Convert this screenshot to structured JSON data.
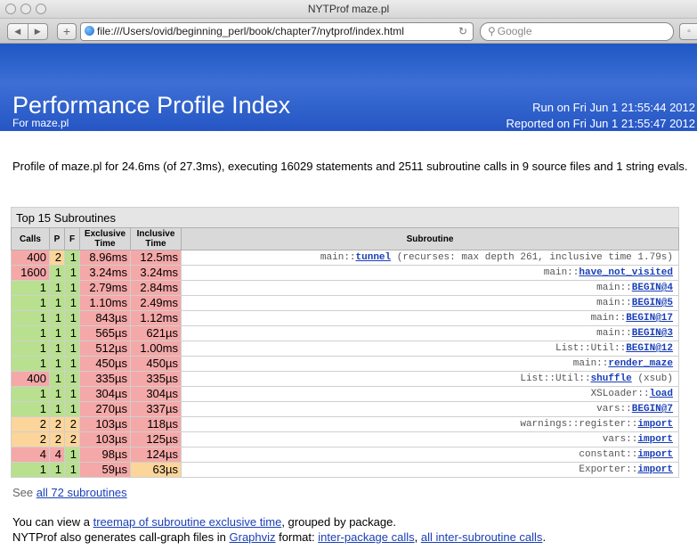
{
  "window": {
    "title": "NYTProf maze.pl"
  },
  "toolbar": {
    "url": "file:///Users/ovid/beginning_perl/book/chapter7/nytprof/index.html",
    "search_placeholder": "Google"
  },
  "header": {
    "title": "Performance Profile Index",
    "subtitle": "For maze.pl",
    "run_on": "Run on Fri Jun 1 21:55:44 2012",
    "reported_on": "Reported on Fri Jun 1 21:55:47 2012"
  },
  "summary": "Profile of maze.pl for 24.6ms (of 27.3ms), executing 16029 statements and 2511 subroutine calls in 9 source files and 1 string evals.",
  "top_subs": {
    "caption": "Top 15 Subroutines",
    "headers": [
      "Calls",
      "P",
      "F",
      "Exclusive Time",
      "Inclusive Time",
      "Subroutine"
    ],
    "rows": [
      {
        "calls": "400",
        "p": "2",
        "f": "1",
        "excl": "8.96ms",
        "incl": "12.5ms",
        "pkg": "main::",
        "name": "tunnel",
        "note": " (recurses: max depth 261, inclusive time 1.79s)",
        "cc": "red",
        "pc": "orange",
        "fc": "green",
        "ec": "red",
        "ic": "red"
      },
      {
        "calls": "1600",
        "p": "1",
        "f": "1",
        "excl": "3.24ms",
        "incl": "3.24ms",
        "pkg": "main::",
        "name": "have_not_visited",
        "note": "",
        "cc": "red",
        "pc": "green",
        "fc": "green",
        "ec": "red",
        "ic": "red"
      },
      {
        "calls": "1",
        "p": "1",
        "f": "1",
        "excl": "2.79ms",
        "incl": "2.84ms",
        "pkg": "main::",
        "name": "BEGIN@4",
        "note": "",
        "cc": "green",
        "pc": "green",
        "fc": "green",
        "ec": "red",
        "ic": "red"
      },
      {
        "calls": "1",
        "p": "1",
        "f": "1",
        "excl": "1.10ms",
        "incl": "2.49ms",
        "pkg": "main::",
        "name": "BEGIN@5",
        "note": "",
        "cc": "green",
        "pc": "green",
        "fc": "green",
        "ec": "red",
        "ic": "red"
      },
      {
        "calls": "1",
        "p": "1",
        "f": "1",
        "excl": "843µs",
        "incl": "1.12ms",
        "pkg": "main::",
        "name": "BEGIN@17",
        "note": "",
        "cc": "green",
        "pc": "green",
        "fc": "green",
        "ec": "red",
        "ic": "red"
      },
      {
        "calls": "1",
        "p": "1",
        "f": "1",
        "excl": "565µs",
        "incl": "621µs",
        "pkg": "main::",
        "name": "BEGIN@3",
        "note": "",
        "cc": "green",
        "pc": "green",
        "fc": "green",
        "ec": "red",
        "ic": "red"
      },
      {
        "calls": "1",
        "p": "1",
        "f": "1",
        "excl": "512µs",
        "incl": "1.00ms",
        "pkg": "List::Util::",
        "name": "BEGIN@12",
        "note": "",
        "cc": "green",
        "pc": "green",
        "fc": "green",
        "ec": "red",
        "ic": "red"
      },
      {
        "calls": "1",
        "p": "1",
        "f": "1",
        "excl": "450µs",
        "incl": "450µs",
        "pkg": "main::",
        "name": "render_maze",
        "note": "",
        "cc": "green",
        "pc": "green",
        "fc": "green",
        "ec": "red",
        "ic": "red"
      },
      {
        "calls": "400",
        "p": "1",
        "f": "1",
        "excl": "335µs",
        "incl": "335µs",
        "pkg": "List::Util::",
        "name": "shuffle",
        "note": " (xsub)",
        "cc": "red",
        "pc": "green",
        "fc": "green",
        "ec": "red",
        "ic": "red"
      },
      {
        "calls": "1",
        "p": "1",
        "f": "1",
        "excl": "304µs",
        "incl": "304µs",
        "pkg": "XSLoader::",
        "name": "load",
        "note": "",
        "cc": "green",
        "pc": "green",
        "fc": "green",
        "ec": "red",
        "ic": "red"
      },
      {
        "calls": "1",
        "p": "1",
        "f": "1",
        "excl": "270µs",
        "incl": "337µs",
        "pkg": "vars::",
        "name": "BEGIN@7",
        "note": "",
        "cc": "green",
        "pc": "green",
        "fc": "green",
        "ec": "red",
        "ic": "red"
      },
      {
        "calls": "2",
        "p": "2",
        "f": "2",
        "excl": "103µs",
        "incl": "118µs",
        "pkg": "warnings::register::",
        "name": "import",
        "note": "",
        "cc": "orange",
        "pc": "orange",
        "fc": "orange",
        "ec": "red",
        "ic": "red"
      },
      {
        "calls": "2",
        "p": "2",
        "f": "2",
        "excl": "103µs",
        "incl": "125µs",
        "pkg": "vars::",
        "name": "import",
        "note": "",
        "cc": "orange",
        "pc": "orange",
        "fc": "orange",
        "ec": "red",
        "ic": "red"
      },
      {
        "calls": "4",
        "p": "4",
        "f": "1",
        "excl": "98µs",
        "incl": "124µs",
        "pkg": "constant::",
        "name": "import",
        "note": "",
        "cc": "red",
        "pc": "red",
        "fc": "green",
        "ec": "red",
        "ic": "red"
      },
      {
        "calls": "1",
        "p": "1",
        "f": "1",
        "excl": "59µs",
        "incl": "63µs",
        "pkg": "Exporter::",
        "name": "import",
        "note": "",
        "cc": "green",
        "pc": "green",
        "fc": "green",
        "ec": "red",
        "ic": "orange"
      }
    ]
  },
  "see_all": {
    "prefix": "See ",
    "link": "all 72 subroutines"
  },
  "footer": {
    "l1_pre": "You can view a ",
    "l1_link": "treemap of subroutine exclusive time",
    "l1_post": ", grouped by package.",
    "l2_pre": "NYTProf also generates call-graph files in ",
    "l2_link1": "Graphviz",
    "l2_mid": " format: ",
    "l2_link2": "inter-package calls",
    "l2_sep": ", ",
    "l2_link3": "all inter-subroutine calls",
    "l2_end": "."
  },
  "colors": {
    "red": "#f4a8a8",
    "green": "#b8e08f",
    "orange": "#fcd59a",
    "header_blue": "#2556c4"
  }
}
